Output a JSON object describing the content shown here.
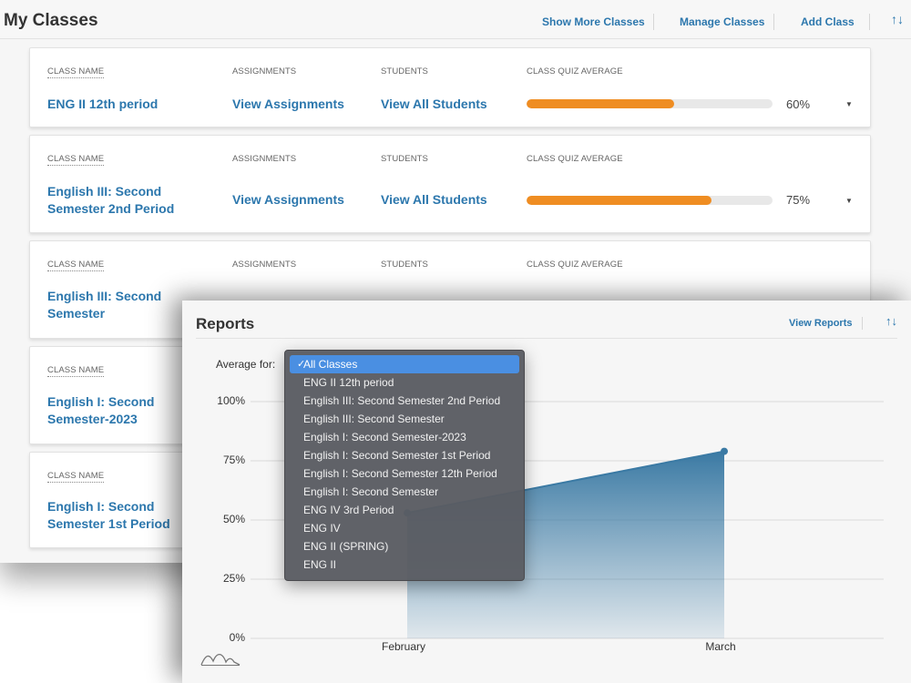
{
  "my_classes": {
    "title": "My Classes",
    "header_links": {
      "show_more": "Show More Classes",
      "manage": "Manage Classes",
      "add": "Add Class"
    },
    "sort_icon": "sort-arrows-icon",
    "columns": {
      "class_name": "CLASS NAME",
      "assignments": "ASSIGNMENTS",
      "students": "STUDENTS",
      "quiz_average": "CLASS QUIZ AVERAGE"
    },
    "rows": [
      {
        "name": "ENG II 12th period",
        "assignments": "View Assignments",
        "students": "View All Students",
        "average": "60%",
        "average_value": 0.6
      },
      {
        "name": "English III: Second Semester 2nd Period",
        "assignments": "View Assignments",
        "students": "View All Students",
        "average": "75%",
        "average_value": 0.75
      },
      {
        "name": "English III: Second Semester"
      },
      {
        "name": "English I: Second Semester-2023"
      },
      {
        "name": "English I: Second Semester 1st Period"
      }
    ],
    "bar_color": "#ef8d22",
    "link_color": "#2c77ad"
  },
  "reports": {
    "title": "Reports",
    "view_reports": "View Reports",
    "sort_icon": "sort-arrows-icon",
    "average_for_label": "Average for:",
    "chart_icon": "area-chart-icon",
    "dropdown": {
      "selected": "All Classes",
      "check": "✓",
      "options": [
        "ENG II 12th period",
        "English III: Second Semester 2nd Period",
        "English III: Second Semester",
        "English I: Second Semester-2023",
        "English I: Second Semester 1st Period",
        "English I: Second Semester 12th Period",
        "English I: Second Semester",
        "ENG IV 3rd Period",
        "ENG IV",
        "ENG II (SPRING)",
        "ENG II"
      ]
    }
  },
  "chart_data": {
    "type": "area",
    "categories": [
      "February",
      "March"
    ],
    "values": [
      53,
      79
    ],
    "y_ticks": [
      "0%",
      "25%",
      "50%",
      "75%",
      "100%"
    ],
    "ylim": [
      0,
      100
    ],
    "grid": true,
    "color": "#3b7aa4"
  }
}
